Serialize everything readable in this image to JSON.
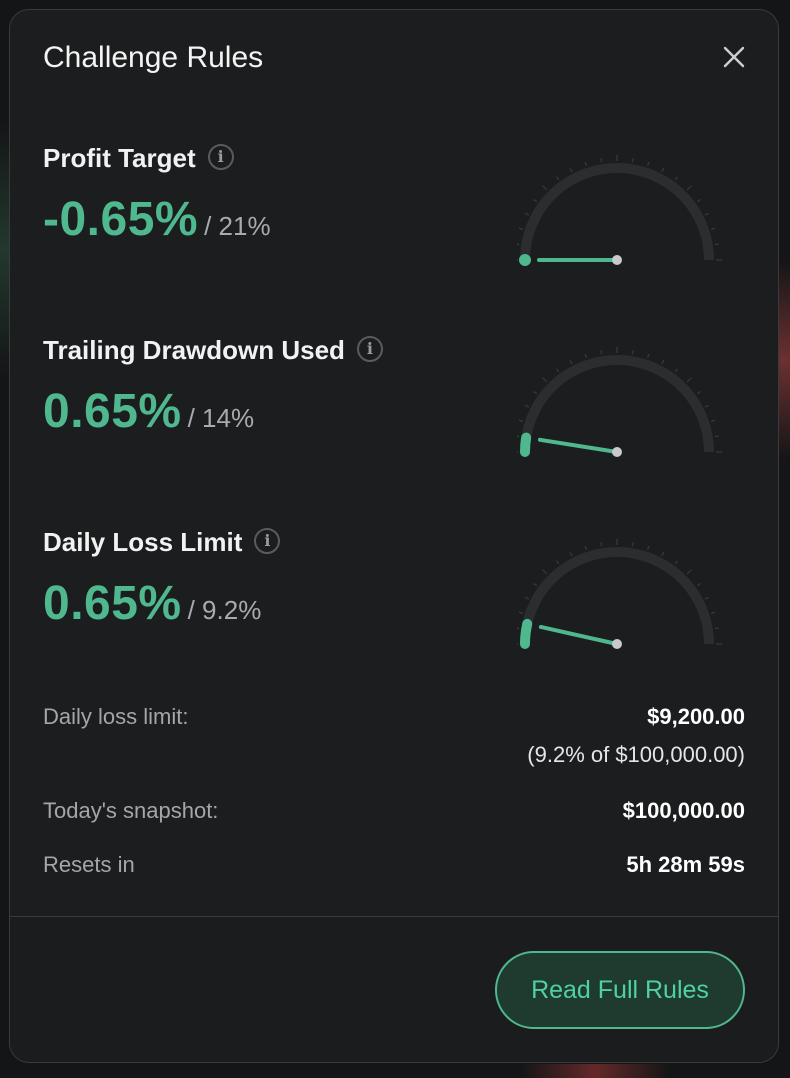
{
  "modal": {
    "title": "Challenge Rules"
  },
  "rules": [
    {
      "title": "Profit Target",
      "value": "-0.65%",
      "limit": "/ 21%",
      "level_fraction": 0.0
    },
    {
      "title": "Trailing Drawdown Used",
      "value": "0.65%",
      "limit": "/ 14%",
      "level_fraction": 0.05
    },
    {
      "title": "Daily Loss Limit",
      "value": "0.65%",
      "limit": "/ 9.2%",
      "level_fraction": 0.07
    }
  ],
  "details": {
    "daily_loss_label": "Daily loss limit:",
    "daily_loss_value": "$9,200.00",
    "daily_loss_sub": "(9.2% of $100,000.00)",
    "snapshot_label": "Today's snapshot:",
    "snapshot_value": "$100,000.00",
    "resets_label": "Resets in",
    "resets_value": "5h 28m 59s"
  },
  "footer": {
    "read_full_rules": "Read Full Rules"
  },
  "icons": {
    "close": "close-icon",
    "info": "info-icon"
  },
  "colors": {
    "accent": "#4fb88e",
    "background": "#1c1d1e",
    "gauge_track": "#2c2d2f"
  }
}
